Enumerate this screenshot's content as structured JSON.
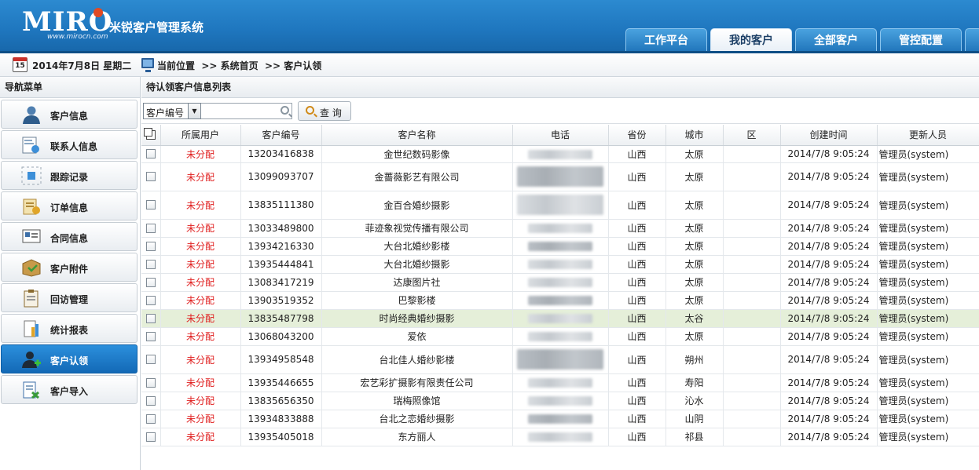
{
  "app": {
    "logo_text": "MIRO",
    "logo_url": "www.mirocn.com",
    "system_name": "米锐客户管理系统"
  },
  "top_tabs": [
    {
      "label": "工作平台",
      "active": false
    },
    {
      "label": "我的客户",
      "active": true
    },
    {
      "label": "全部客户",
      "active": false
    },
    {
      "label": "管控配置",
      "active": false
    }
  ],
  "breadcrumb": {
    "calendar_day": "15",
    "date": "2014年7月8日 星期二",
    "path": "当前位置  >> 系统首页  >> 客户认领"
  },
  "sidebar": {
    "title": "导航菜单",
    "items": [
      {
        "label": "客户信息",
        "icon": "user-icon",
        "active": false
      },
      {
        "label": "联系人信息",
        "icon": "contact-card-icon",
        "active": false
      },
      {
        "label": "跟踪记录",
        "icon": "tracking-icon",
        "active": false
      },
      {
        "label": "订单信息",
        "icon": "order-icon",
        "active": false
      },
      {
        "label": "合同信息",
        "icon": "contract-icon",
        "active": false
      },
      {
        "label": "客户附件",
        "icon": "box-icon",
        "active": false
      },
      {
        "label": "回访管理",
        "icon": "clipboard-icon",
        "active": false
      },
      {
        "label": "统计报表",
        "icon": "report-icon",
        "active": false
      },
      {
        "label": "客户认领",
        "icon": "user-add-icon",
        "active": true
      },
      {
        "label": "客户导入",
        "icon": "import-icon",
        "active": false
      }
    ]
  },
  "list": {
    "title": "待认领客户信息列表",
    "search": {
      "field": "客户编号",
      "value": "",
      "button": "查 询"
    },
    "columns": [
      "所属用户",
      "客户编号",
      "客户名称",
      "电话",
      "省份",
      "城市",
      "区",
      "创建时间",
      "更新人员"
    ],
    "rows": [
      {
        "owner": "未分配",
        "code": "13203416838",
        "name": "金世纪数码影像",
        "phone": "085...11",
        "province": "山西",
        "city": "太原",
        "district": "",
        "created": "2014/7/8 9:05:24",
        "updater": "管理员(system)"
      },
      {
        "owner": "未分配",
        "code": "13099093707",
        "name": "金薔薇影艺有限公司",
        "phone": "0...8",
        "province": "山西",
        "city": "太原",
        "district": "",
        "created": "2014/7/8 9:05:24",
        "updater": "管理员(system)"
      },
      {
        "owner": "未分配",
        "code": "13835111380",
        "name": "金百合婚纱摄影",
        "phone": "0...3",
        "province": "山西",
        "city": "太原",
        "district": "",
        "created": "2014/7/8 9:05:24",
        "updater": "管理员(system)"
      },
      {
        "owner": "未分配",
        "code": "13033489800",
        "name": "菲迹象视觉传播有限公司",
        "phone": "",
        "province": "山西",
        "city": "太原",
        "district": "",
        "created": "2014/7/8 9:05:24",
        "updater": "管理员(system)"
      },
      {
        "owner": "未分配",
        "code": "13934216330",
        "name": "大台北婚纱影楼",
        "phone": "",
        "province": "山西",
        "city": "太原",
        "district": "",
        "created": "2014/7/8 9:05:24",
        "updater": "管理员(system)"
      },
      {
        "owner": "未分配",
        "code": "13935444841",
        "name": "大台北婚纱摄影",
        "phone": "",
        "province": "山西",
        "city": "太原",
        "district": "",
        "created": "2014/7/8 9:05:24",
        "updater": "管理员(system)"
      },
      {
        "owner": "未分配",
        "code": "13083417219",
        "name": "达康图片社",
        "phone": "",
        "province": "山西",
        "city": "太原",
        "district": "",
        "created": "2014/7/8 9:05:24",
        "updater": "管理员(system)"
      },
      {
        "owner": "未分配",
        "code": "13903519352",
        "name": "巴黎影楼",
        "phone": "",
        "province": "山西",
        "city": "太原",
        "district": "",
        "created": "2014/7/8 9:05:24",
        "updater": "管理员(system)"
      },
      {
        "owner": "未分配",
        "code": "13835487798",
        "name": "时尚经典婚纱摄影",
        "phone": "",
        "province": "山西",
        "city": "太谷",
        "district": "",
        "created": "2014/7/8 9:05:24",
        "updater": "管理员(system)"
      },
      {
        "owner": "未分配",
        "code": "13068043200",
        "name": "爱依",
        "phone": "",
        "province": "山西",
        "city": "太原",
        "district": "",
        "created": "2014/7/8 9:05:24",
        "updater": "管理员(system)"
      },
      {
        "owner": "未分配",
        "code": "13934958548",
        "name": "台北佳人婚纱影楼",
        "phone": "",
        "province": "山西",
        "city": "朔州",
        "district": "",
        "created": "2014/7/8 9:05:24",
        "updater": "管理员(system)"
      },
      {
        "owner": "未分配",
        "code": "13935446655",
        "name": "宏艺彩扩摄影有限责任公司",
        "phone": "",
        "province": "山西",
        "city": "寿阳",
        "district": "",
        "created": "2014/7/8 9:05:24",
        "updater": "管理员(system)"
      },
      {
        "owner": "未分配",
        "code": "13835656350",
        "name": "瑞梅照像馆",
        "phone": "",
        "province": "山西",
        "city": "沁水",
        "district": "",
        "created": "2014/7/8 9:05:24",
        "updater": "管理员(system)"
      },
      {
        "owner": "未分配",
        "code": "13934833888",
        "name": "台北之恋婚纱摄影",
        "phone": "",
        "province": "山西",
        "city": "山阴",
        "district": "",
        "created": "2014/7/8 9:05:24",
        "updater": "管理员(system)"
      },
      {
        "owner": "未分配",
        "code": "13935405018",
        "name": "东方丽人",
        "phone": "",
        "province": "山西",
        "city": "祁县",
        "district": "",
        "created": "2014/7/8 9:05:24",
        "updater": "管理员(system)"
      }
    ]
  },
  "colors": {
    "header_blue": "#1f77bf",
    "active_nav": "#1a7bc9",
    "unassigned_red": "#e02020",
    "highlight_row": "#e5efd9"
  }
}
